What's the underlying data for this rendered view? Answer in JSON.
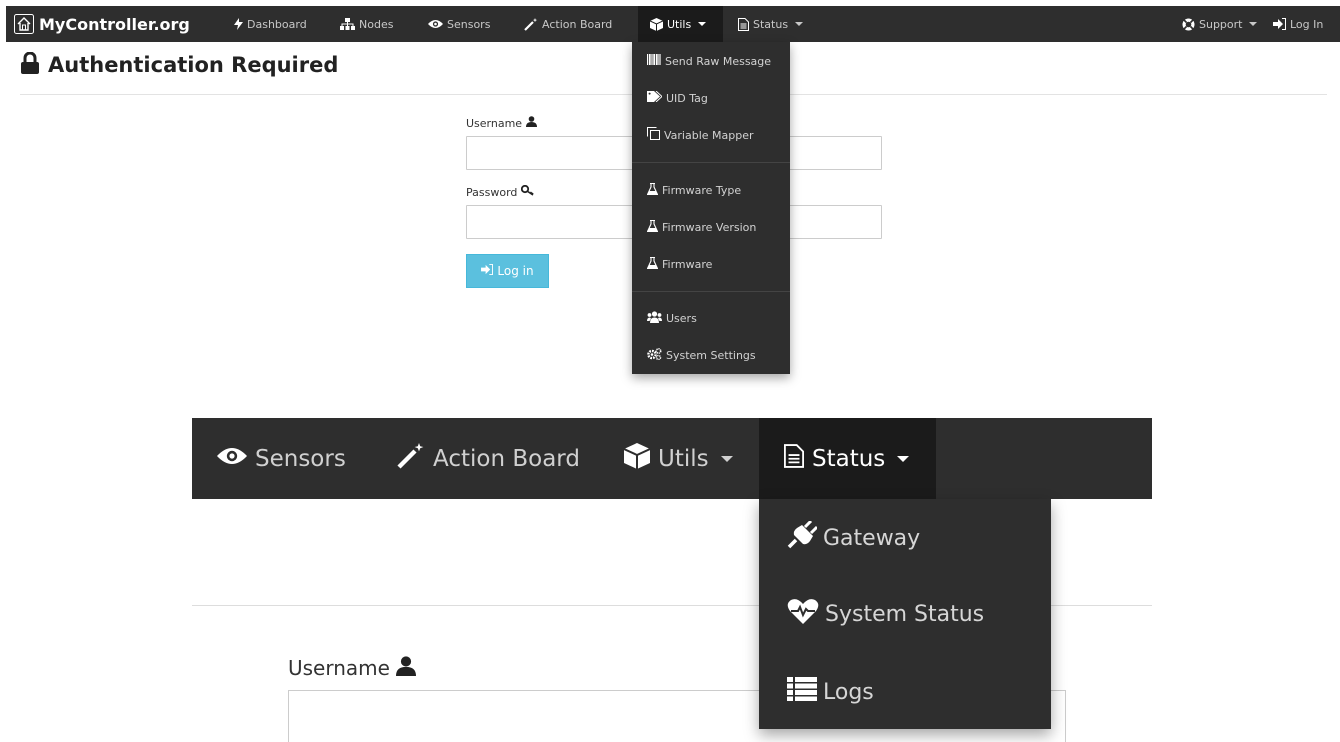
{
  "navbar": {
    "brand": "MyController.org",
    "items": [
      {
        "label": "Dashboard",
        "icon": "bolt-icon"
      },
      {
        "label": "Nodes",
        "icon": "sitemap-icon"
      },
      {
        "label": "Sensors",
        "icon": "eye-icon"
      },
      {
        "label": "Action Board",
        "icon": "magic-icon"
      },
      {
        "label": "Utils",
        "icon": "cube-icon"
      },
      {
        "label": "Status",
        "icon": "file-text-icon"
      }
    ],
    "right": [
      {
        "label": "Support",
        "icon": "life-ring-icon"
      },
      {
        "label": "Log In",
        "icon": "sign-in-icon"
      }
    ]
  },
  "page": {
    "title": "Authentication Required",
    "username_label": "Username",
    "password_label": "Password",
    "username_value": "",
    "password_value": "",
    "login_button": "Log in"
  },
  "utils_menu": {
    "items": [
      {
        "label": "Send Raw Message",
        "icon": "barcode-icon"
      },
      {
        "label": "UID Tag",
        "icon": "tags-icon"
      },
      {
        "label": "Variable Mapper",
        "icon": "clone-icon"
      },
      {
        "label": "Firmware Type",
        "icon": "flask-icon"
      },
      {
        "label": "Firmware Version",
        "icon": "flask-icon"
      },
      {
        "label": "Firmware",
        "icon": "flask-icon"
      },
      {
        "label": "Users",
        "icon": "users-icon"
      },
      {
        "label": "System Settings",
        "icon": "cogs-icon"
      }
    ]
  },
  "zoom": {
    "nav": [
      {
        "label": "Sensors",
        "icon": "eye-icon"
      },
      {
        "label": "Action Board",
        "icon": "magic-icon"
      },
      {
        "label": "Utils",
        "icon": "cube-icon"
      },
      {
        "label": "Status",
        "icon": "file-text-icon"
      }
    ],
    "status_menu": [
      {
        "label": "Gateway",
        "icon": "plug-icon"
      },
      {
        "label": "System Status",
        "icon": "heartbeat-icon"
      },
      {
        "label": "Logs",
        "icon": "list-icon"
      }
    ],
    "username_label": "Username"
  },
  "colors": {
    "navbar_bg": "#2e2e2e",
    "active_bg": "#1b1b1b",
    "login_button_bg": "#5bc0de"
  }
}
